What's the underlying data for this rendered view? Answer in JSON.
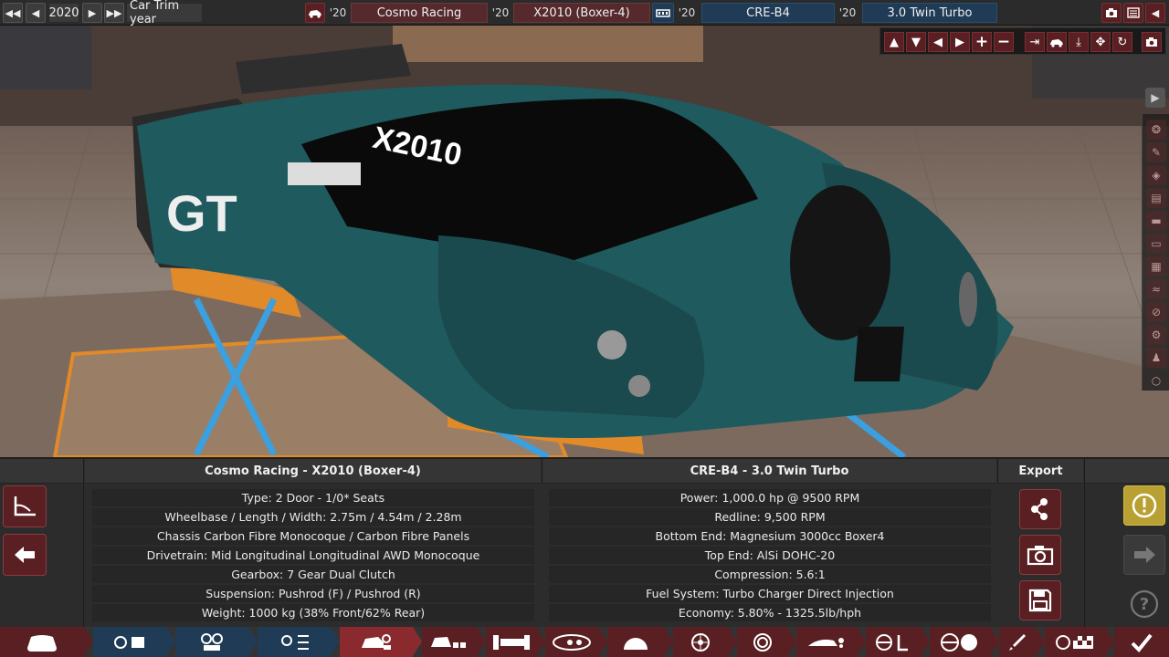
{
  "topbar": {
    "year": "2020",
    "trim_label": "Car Trim year",
    "model_year": "'20",
    "company": "Cosmo Racing",
    "family_year": "'20",
    "model_family": "X2010 (Boxer-4)",
    "engine_year": "'20",
    "engine_family": "CRE-B4",
    "variant_year": "'20",
    "engine_variant": "3.0 Twin Turbo"
  },
  "car_panel": {
    "title": "Cosmo Racing - X2010 (Boxer-4)",
    "rows": [
      "Type: 2 Door - 1/0* Seats",
      "Wheelbase / Length / Width: 2.75m / 4.54m / 2.28m",
      "Chassis Carbon Fibre Monocoque / Carbon Fibre Panels",
      "Drivetrain: Mid Longitudinal Longitudinal AWD Monocoque",
      "Gearbox: 7 Gear Dual Clutch",
      "Suspension: Pushrod (F) / Pushrod (R)",
      "Weight: 1000 kg (38% Front/62% Rear)"
    ]
  },
  "engine_panel": {
    "title": "CRE-B4 - 3.0 Twin Turbo",
    "rows": [
      "Power: 1,000.0 hp @ 9500 RPM",
      "Redline:  9,500 RPM",
      "Bottom End: Magnesium 3000cc Boxer4",
      "Top End: AlSi DOHC-20",
      "Compression: 5.6:1",
      "Fuel System: Turbo Charger Direct Injection",
      "Economy: 5.80% - 1325.5lb/hph"
    ]
  },
  "export": {
    "title": "Export"
  },
  "car_decal": {
    "gt": "GT",
    "number": "X2010"
  },
  "colors": {
    "accent_red": "#5a1f22",
    "accent_blue": "#1f3b55",
    "warning": "#b8a032",
    "car_body": "#1f5a5e"
  }
}
